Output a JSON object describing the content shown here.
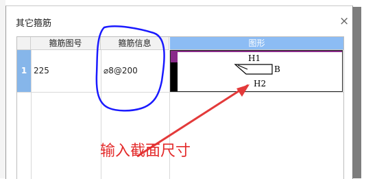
{
  "dialog": {
    "title": "其它箍筋",
    "close_glyph": "×"
  },
  "table": {
    "headers": [
      "箍筋图号",
      "箍筋信息",
      "图形"
    ],
    "rows": [
      {
        "index": "1",
        "figure_no": "225",
        "info": "⌀8@200"
      }
    ]
  },
  "shape": {
    "labels": {
      "h1": "H1",
      "h2": "H2",
      "b": "B"
    }
  },
  "annotation": {
    "text": "输入截面尺寸",
    "color": "#e32a2a",
    "circle_color": "#1a1aff"
  }
}
